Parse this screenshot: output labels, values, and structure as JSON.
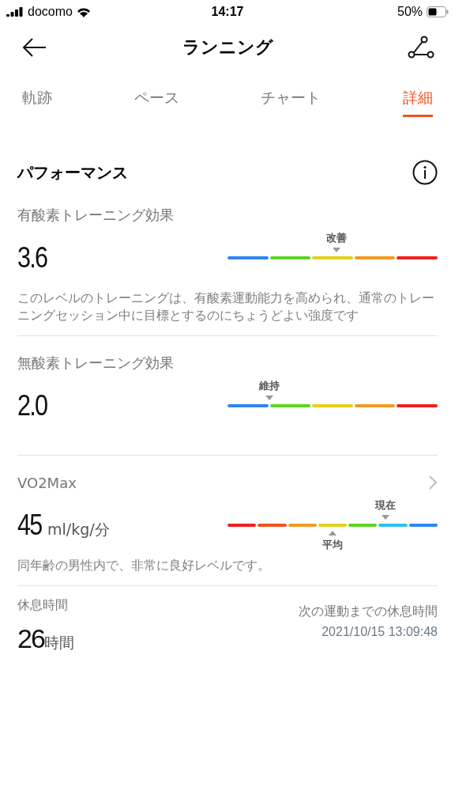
{
  "status_bar": {
    "carrier": "docomo",
    "time": "14:17",
    "battery": "50%"
  },
  "header": {
    "title": "ランニング"
  },
  "tabs": [
    {
      "label": "軌跡",
      "selected": false
    },
    {
      "label": "ペース",
      "selected": false
    },
    {
      "label": "チャート",
      "selected": false
    },
    {
      "label": "詳細",
      "selected": true
    }
  ],
  "section": {
    "title": "パフォーマンス"
  },
  "metrics": [
    {
      "label": "有酸素トレーニング効果",
      "value": "3.6",
      "chevron": false,
      "gauge": {
        "segments": [
          {
            "color": "#2f86f0"
          },
          {
            "color": "#5cd424"
          },
          {
            "color": "#e6cf1e"
          },
          {
            "color": "#f29a22"
          },
          {
            "color": "#f0201e"
          }
        ],
        "markers": [
          {
            "label": "改善",
            "kind": "above"
          }
        ]
      },
      "description": "このレベルのトレーニングは、有酸素運動能力を高められ、通常のトレーニングセッション中に目標とするのにちょうどよい強度です"
    },
    {
      "label": "無酸素トレーニング効果",
      "value": "2.0",
      "chevron": false,
      "gauge": {
        "segments": [
          {
            "color": "#2f86f0"
          },
          {
            "color": "#5cd424"
          },
          {
            "color": "#e6cf1e"
          },
          {
            "color": "#f29a22"
          },
          {
            "color": "#f0201e"
          }
        ],
        "markers": [
          {
            "label": "維持",
            "kind": "above"
          }
        ]
      }
    },
    {
      "label": "VO2Max",
      "value": "45",
      "unit": "ml/kg/分",
      "chevron": true,
      "gauge": {
        "segments": [
          {
            "color": "#f0201e"
          },
          {
            "color": "#f2521e"
          },
          {
            "color": "#f29a22"
          },
          {
            "color": "#e6cf1e"
          },
          {
            "color": "#5cd424"
          },
          {
            "color": "#2cc0ef"
          },
          {
            "color": "#2f86f0"
          }
        ],
        "markers": [
          {
            "label": "現在",
            "level": 0.75,
            "kind": "above"
          },
          {
            "label": "平均",
            "kind": "below"
          }
        ]
      },
      "description": "同年齢の男性内で、非常に良好レベルです。"
    }
  ],
  "rest": {
    "label": "休息時間",
    "value": "26",
    "unit": "時間",
    "caption": "次の運動までの休息時間",
    "datetime": "2021/10/15 13:09:48"
  }
}
